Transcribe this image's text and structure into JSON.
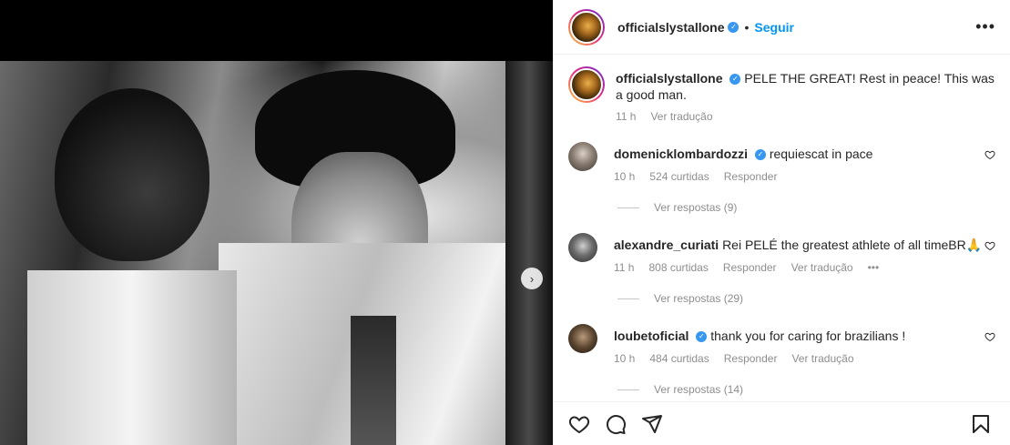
{
  "post": {
    "author": "officialslystallone",
    "follow_label": "Seguir",
    "dot": "•",
    "more_label": "•••",
    "next_label": "›"
  },
  "caption": {
    "username": "officialslystallone",
    "text": "PELE THE GREAT! Rest in peace! This was a good man.",
    "time": "11 h",
    "translate": "Ver tradução"
  },
  "comments": [
    {
      "username": "domenicklombardozzi",
      "text": "requiescat in pace",
      "time": "10 h",
      "likes": "524 curtidas",
      "reply": "Responder",
      "translate": "",
      "replies": "Ver respostas (9)"
    },
    {
      "username": "alexandre_curiati",
      "text": "Rei PELÉ the greatest athlete of all timeBR🙏",
      "time": "11 h",
      "likes": "808 curtidas",
      "reply": "Responder",
      "translate": "Ver tradução",
      "more": "•••",
      "replies": "Ver respostas (29)"
    },
    {
      "username": "loubetoficial",
      "text": "thank you for caring for brazilians !",
      "time": "10 h",
      "likes": "484 curtidas",
      "reply": "Responder",
      "translate": "Ver tradução",
      "replies": "Ver respostas (14)"
    }
  ],
  "icons": {
    "like": "heart-icon",
    "comment": "comment-icon",
    "share": "send-icon",
    "save": "bookmark-icon"
  },
  "colors": {
    "accent": "#0095f6",
    "verified": "#3897f0",
    "muted": "#8e8e8e"
  }
}
